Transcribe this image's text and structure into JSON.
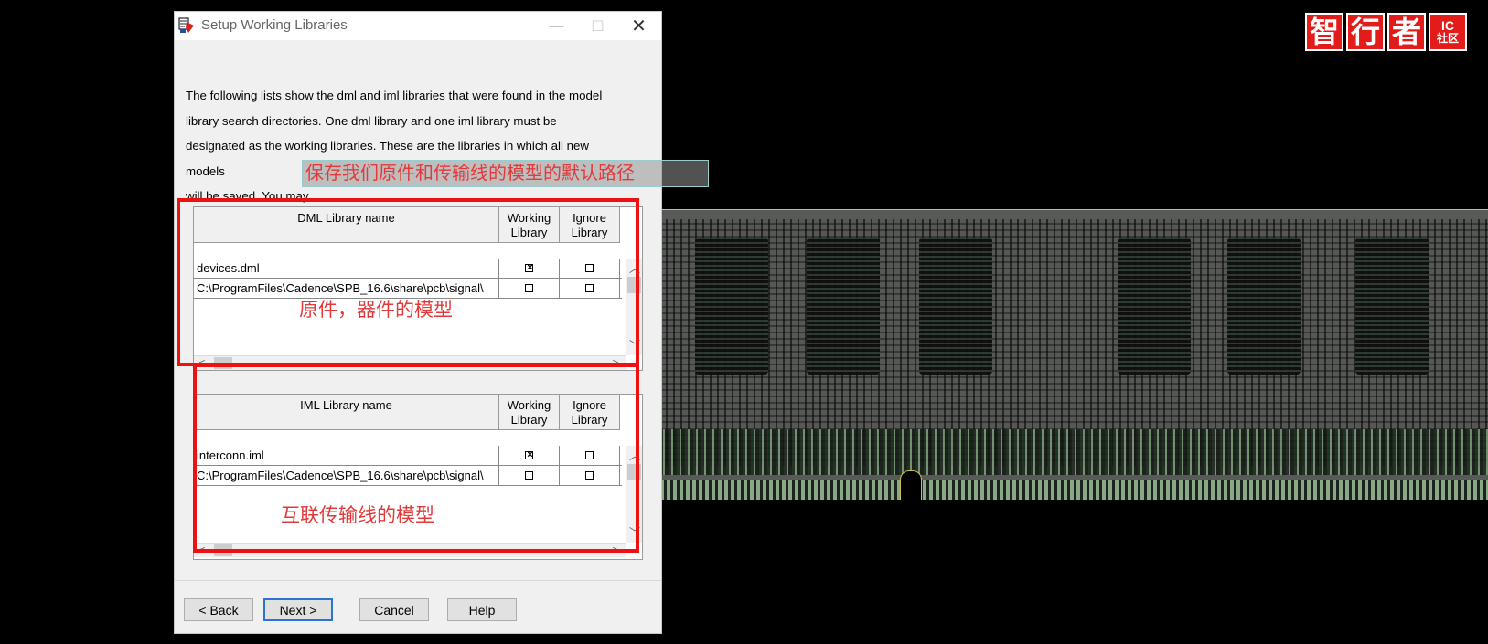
{
  "window": {
    "title": "Setup Working Libraries",
    "minimize": "—",
    "maximize": "☐",
    "close": "✕"
  },
  "description": [
    "The following lists show the dml and iml libraries that were found in the model",
    "library search directories. One dml library and one iml library must be",
    "designated as the working libraries. These are the libraries in which all new models",
    "will be saved. You may"
  ],
  "annotations": {
    "top": "保存我们原件和传输线的模型的默认路径",
    "dml": "原件，器件的模型",
    "iml": "互联传输线的模型"
  },
  "dml_table": {
    "headers": {
      "name": "DML Library name",
      "working_1": "Working",
      "working_2": "Library",
      "ignore_1": "Ignore",
      "ignore_2": "Library"
    },
    "rows": [
      {
        "name": "devices.dml",
        "working": true,
        "ignore": false
      },
      {
        "name": "C:\\ProgramFiles\\Cadence\\SPB_16.6\\share\\pcb\\signal\\",
        "working": false,
        "ignore": false
      }
    ]
  },
  "iml_table": {
    "headers": {
      "name": "IML Library name",
      "working_1": "Working",
      "working_2": "Library",
      "ignore_1": "Ignore",
      "ignore_2": "Library"
    },
    "rows": [
      {
        "name": "interconn.iml",
        "working": true,
        "ignore": false
      },
      {
        "name": "C:\\ProgramFiles\\Cadence\\SPB_16.6\\share\\pcb\\signal\\",
        "working": false,
        "ignore": false
      }
    ]
  },
  "buttons": {
    "back": "< Back",
    "next": "Next >",
    "cancel": "Cancel",
    "help": "Help"
  },
  "scroll": {
    "up": "︿",
    "down": "﹀",
    "left": "<",
    "right": ">"
  },
  "logo": {
    "chars": [
      "智",
      "行",
      "者"
    ],
    "ic_1": "IC",
    "ic_2": "社区"
  },
  "colors": {
    "annotation_red": "#ee1111",
    "logo_red": "#e21b1b",
    "default_button": "#2d74d0"
  }
}
